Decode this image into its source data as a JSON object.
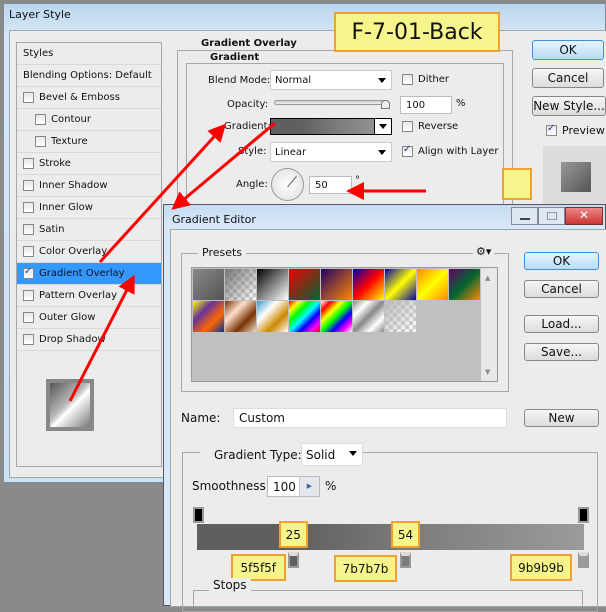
{
  "layer_style": {
    "title": "Layer Style",
    "sidebar": {
      "header": "Styles",
      "blending": "Blending Options: Default",
      "items": [
        {
          "label": "Bevel & Emboss",
          "checked": false,
          "indent": false
        },
        {
          "label": "Contour",
          "checked": false,
          "indent": true
        },
        {
          "label": "Texture",
          "checked": false,
          "indent": true
        },
        {
          "label": "Stroke",
          "checked": false,
          "indent": false
        },
        {
          "label": "Inner Shadow",
          "checked": false,
          "indent": false
        },
        {
          "label": "Inner Glow",
          "checked": false,
          "indent": false
        },
        {
          "label": "Satin",
          "checked": false,
          "indent": false
        },
        {
          "label": "Color Overlay",
          "checked": false,
          "indent": false
        },
        {
          "label": "Gradient Overlay",
          "checked": true,
          "indent": false,
          "selected": true
        },
        {
          "label": "Pattern Overlay",
          "checked": false,
          "indent": false
        },
        {
          "label": "Outer Glow",
          "checked": false,
          "indent": false
        },
        {
          "label": "Drop Shadow",
          "checked": false,
          "indent": false
        }
      ]
    },
    "panel": {
      "section": "Gradient Overlay",
      "group": "Gradient",
      "blend_mode_label": "Blend Mode:",
      "blend_mode": "Normal",
      "dither": "Dither",
      "dither_checked": false,
      "opacity_label": "Opacity:",
      "opacity": "100",
      "opacity_unit": "%",
      "gradient_label": "Gradient:",
      "reverse": "Reverse",
      "reverse_checked": false,
      "style_label": "Style:",
      "style": "Linear",
      "align": "Align with Layer",
      "align_checked": true,
      "angle_label": "Angle:",
      "angle": "50",
      "angle_unit": "°"
    },
    "buttons": {
      "ok": "OK",
      "cancel": "Cancel",
      "new_style": "New Style...",
      "preview": "Preview",
      "preview_checked": true
    }
  },
  "annotation": {
    "title": "F-7-01-Back",
    "highlight_color": "#f5f58c",
    "border_color": "#f0a030",
    "arrow_color": "#ff0000"
  },
  "gradient_editor": {
    "title": "Gradient Editor",
    "presets_label": "Presets",
    "presets": [
      [
        "#888",
        "#555"
      ],
      [
        "#777",
        "transparent"
      ],
      [
        "#000",
        "#fff"
      ],
      [
        "#e00",
        "#063"
      ],
      [
        "#206",
        "#f80"
      ],
      [
        "#00a",
        "#f00",
        "#ff0"
      ],
      [
        "#00a",
        "#ff0",
        "#00a"
      ],
      [
        "#f80",
        "#ff0",
        "#f80"
      ],
      [
        "#606",
        "#063",
        "#f80"
      ],
      [
        "#ff0",
        "#639",
        "#f60",
        "#039"
      ],
      [
        "#730",
        "#fdc",
        "#730",
        "#edc"
      ],
      [
        "#39c",
        "#fff",
        "#c80",
        "#fff"
      ],
      [
        "#f00",
        "#ff0",
        "#0f0",
        "#0ff",
        "#00f",
        "#f0f",
        "#f00"
      ],
      [
        "#fff",
        "#f00",
        "#ff0",
        "#0f0",
        "#00f",
        "#f0f",
        "#fff"
      ],
      [
        "#888",
        "#fff",
        "#888",
        "#fff",
        "#888"
      ],
      [
        "#bbb",
        "transparent"
      ]
    ],
    "buttons": {
      "ok": "OK",
      "cancel": "Cancel",
      "load": "Load...",
      "save": "Save...",
      "new": "New"
    },
    "name_label": "Name:",
    "name": "Custom",
    "gradient_type_label": "Gradient Type:",
    "gradient_type": "Solid",
    "smoothness_label": "Smoothness:",
    "smoothness": "100",
    "smoothness_unit": "%",
    "color_stops": [
      {
        "location": 25,
        "color": "#5f5f5f",
        "label": "5f5f5f",
        "loc_label": "25"
      },
      {
        "location": 54,
        "color": "#7b7b7b",
        "label": "7b7b7b",
        "loc_label": "54"
      },
      {
        "location": 100,
        "color": "#9b9b9b",
        "label": "9b9b9b"
      }
    ],
    "stops_label": "Stops"
  }
}
